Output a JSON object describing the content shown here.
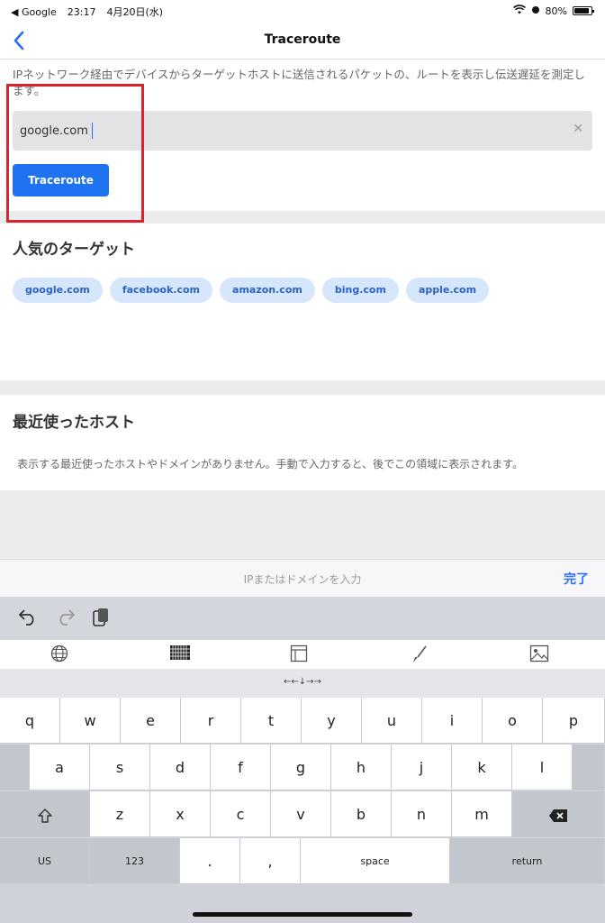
{
  "status_bar": {
    "back_app": "◀ Google",
    "time": "23:17",
    "date": "4月20日(水)",
    "battery": "80%"
  },
  "nav": {
    "title": "Traceroute"
  },
  "intro": {
    "description": "IPネットワーク経由でデバイスからターゲットホストに送信されるパケットの、ルートを表示し伝送遅延を測定します。",
    "input_value": "google.com",
    "button_label": "Traceroute"
  },
  "popular": {
    "title": "人気のターゲット",
    "targets": [
      "google.com",
      "facebook.com",
      "amazon.com",
      "bing.com",
      "apple.com"
    ]
  },
  "recent": {
    "title": "最近使ったホスト",
    "empty_message": "表示する最近使ったホストやドメインがありません。手動で入力すると、後でこの領域に表示されます。"
  },
  "keyboard_toolbar": {
    "placeholder": "IPまたはドメインを入力",
    "done_label": "完了"
  },
  "keyboard": {
    "arrows": "←←↓→→",
    "row1": [
      "q",
      "w",
      "e",
      "r",
      "t",
      "y",
      "u",
      "i",
      "o",
      "p"
    ],
    "row2": [
      "a",
      "s",
      "d",
      "f",
      "g",
      "h",
      "j",
      "k",
      "l"
    ],
    "row3": [
      "z",
      "x",
      "c",
      "v",
      "b",
      "n",
      "m"
    ],
    "lang_key": "US",
    "num_key": "123",
    "period_key": ".",
    "comma_key": ",",
    "space_key": "space",
    "return_key": "return"
  },
  "colors": {
    "accent": "#1f73f1",
    "highlight": "#d9242b",
    "chip_bg": "#d6e6fb"
  }
}
